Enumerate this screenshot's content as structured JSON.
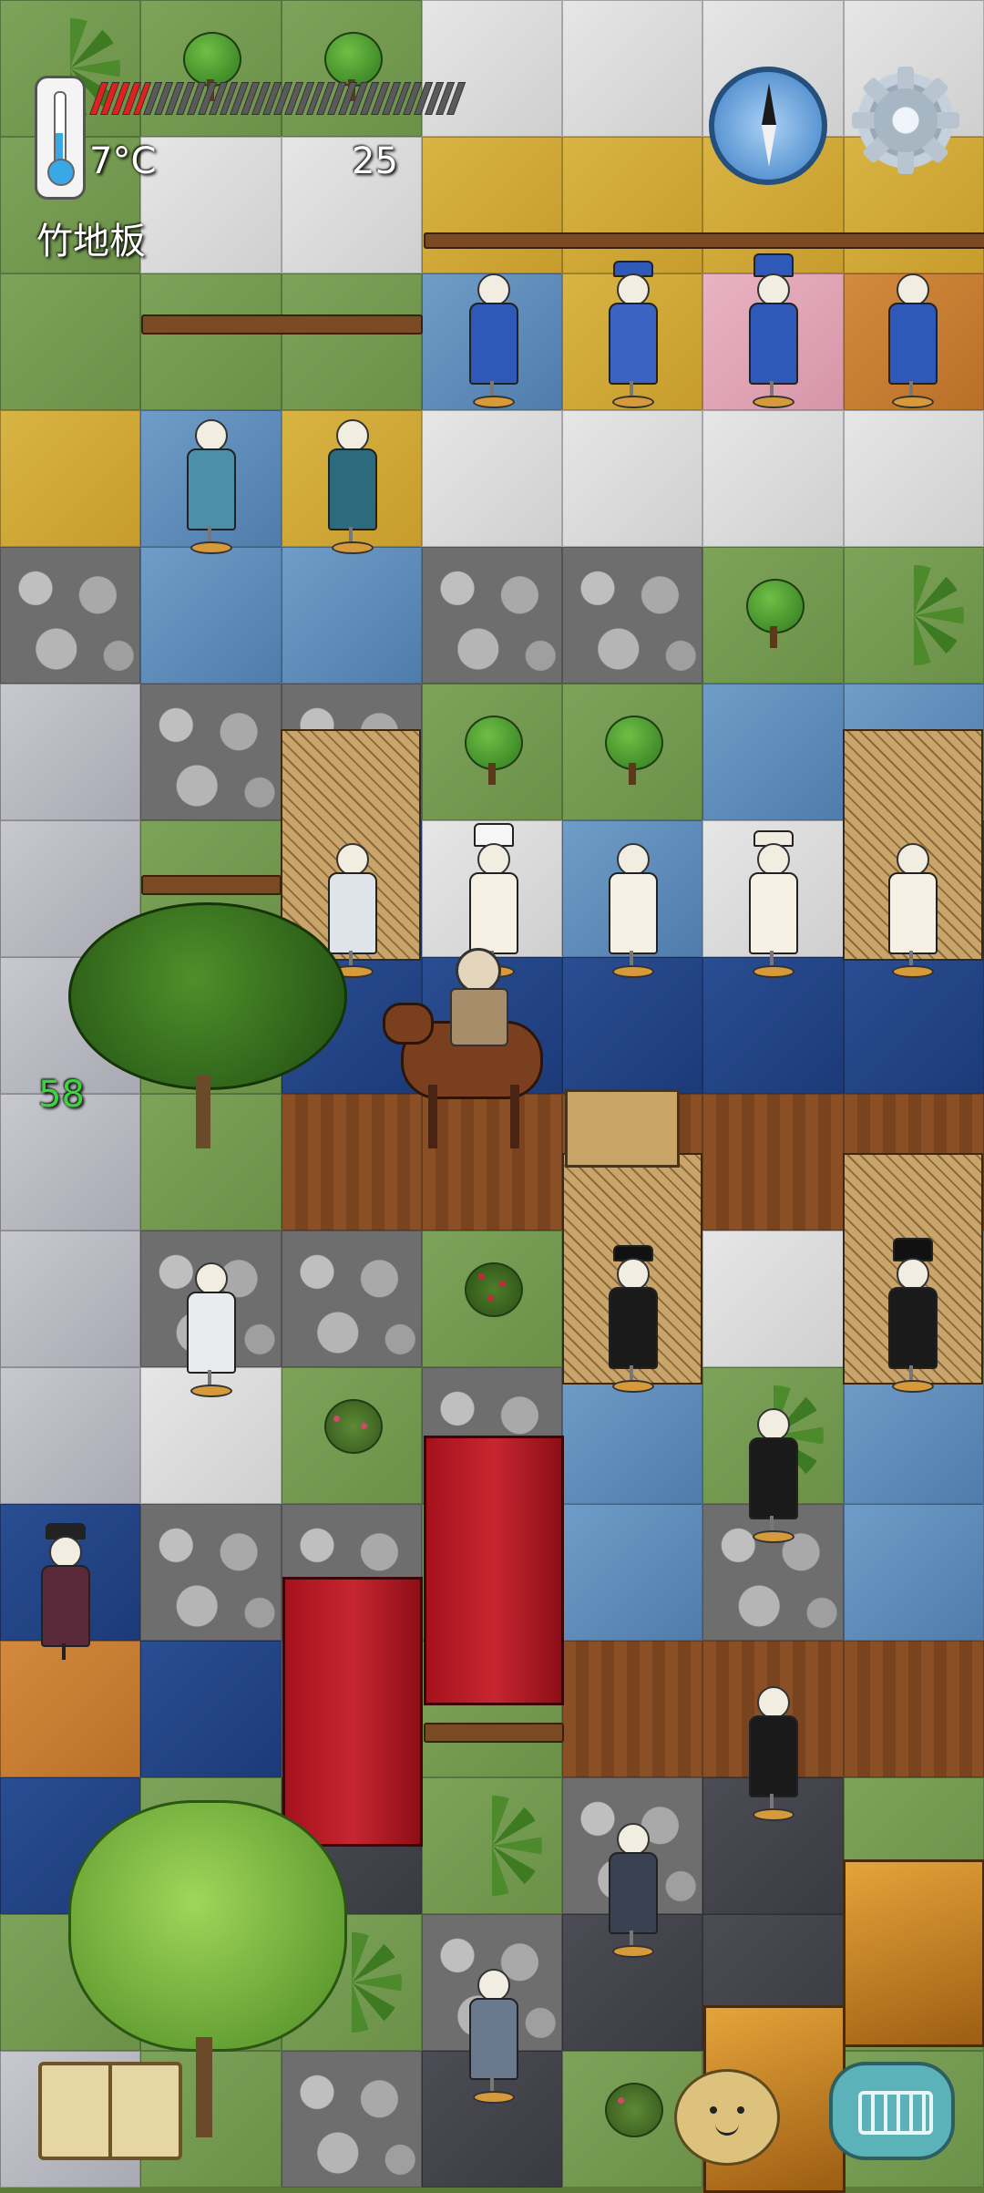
{
  "hud": {
    "temperature": "7°C",
    "hunger_value": "25",
    "tile_name": "竹地板",
    "health_segments_total": 34,
    "health_segments_filled": 5,
    "coordinate": "58"
  },
  "icons": {
    "thermometer": "thermometer-icon",
    "compass": "compass-icon",
    "settings": "gear-icon",
    "journal": "book-icon",
    "chat": "keyboard-icon",
    "emote": "egg-face-icon"
  },
  "colors": {
    "health": "#e0211f",
    "temperature_fill": "#3aa7e6",
    "coordinate_text": "#3cd43c"
  }
}
